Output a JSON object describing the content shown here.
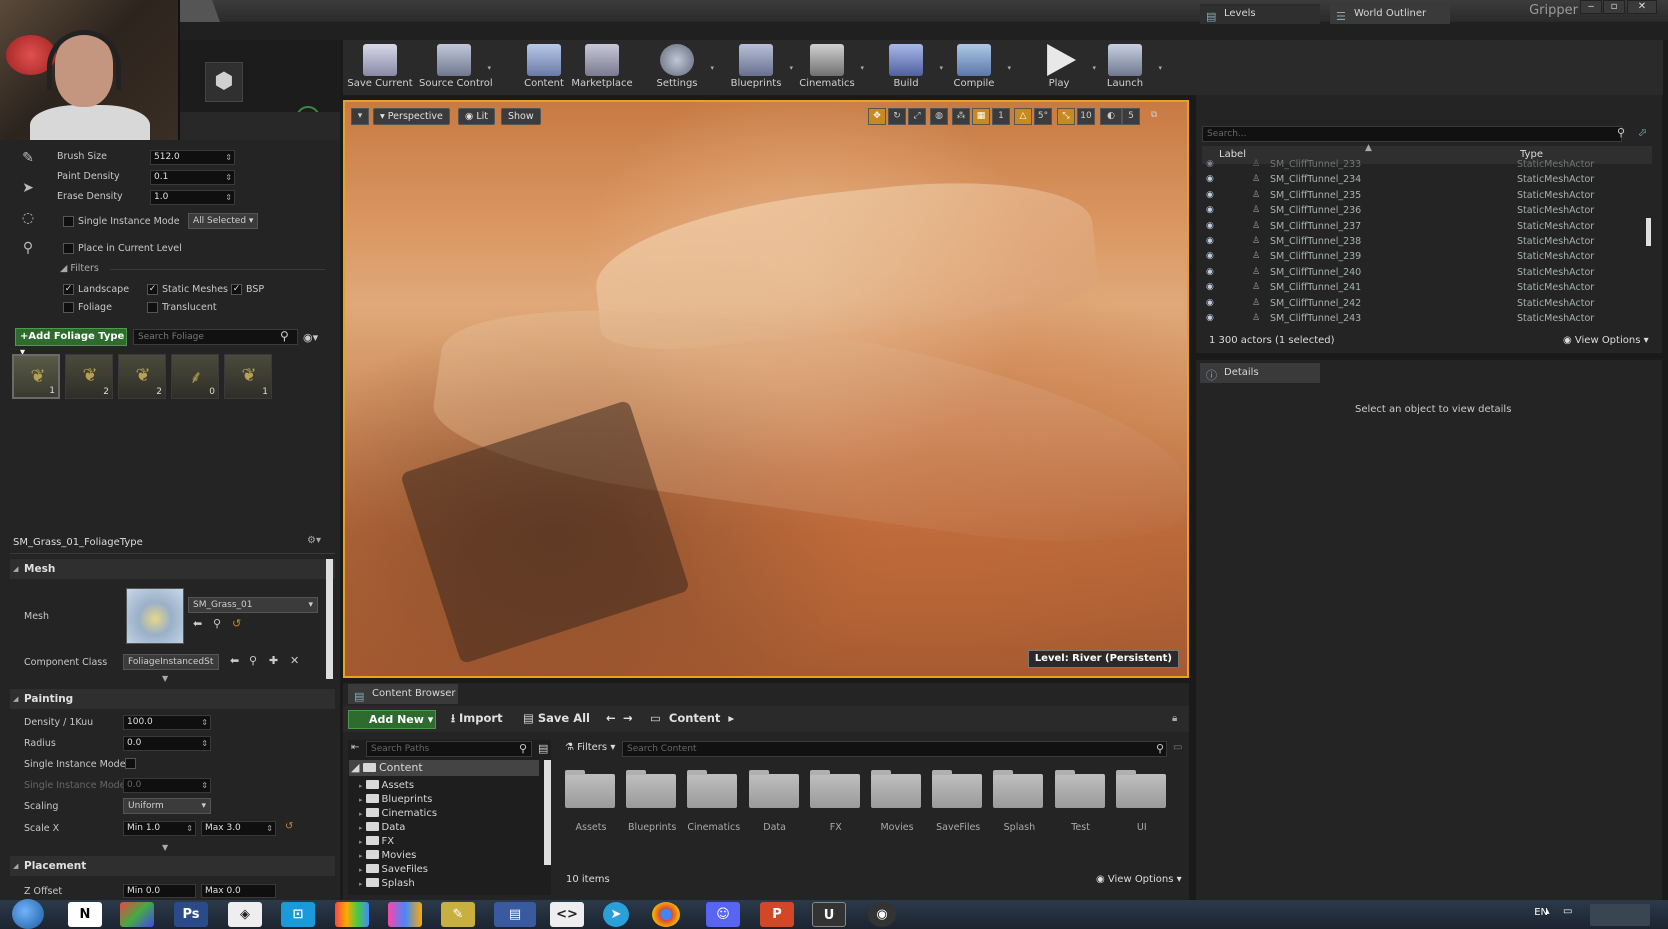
{
  "window": {
    "title": "Gripper",
    "min": "‒",
    "max": "▫",
    "close": "✕"
  },
  "toolbar": {
    "items": [
      {
        "label": "Save Current",
        "icon": "save-icon"
      },
      {
        "label": "Source Control",
        "icon": "source-control-icon"
      },
      {
        "label": "Content",
        "icon": "content-icon"
      },
      {
        "label": "Marketplace",
        "icon": "marketplace-icon"
      },
      {
        "label": "Settings",
        "icon": "settings-icon"
      },
      {
        "label": "Blueprints",
        "icon": "blueprints-icon"
      },
      {
        "label": "Cinematics",
        "icon": "cinematics-icon"
      },
      {
        "label": "Build",
        "icon": "build-icon"
      },
      {
        "label": "Compile",
        "icon": "compile-icon"
      },
      {
        "label": "Play",
        "icon": "play-icon"
      },
      {
        "label": "Launch",
        "icon": "launch-icon"
      }
    ]
  },
  "foliage": {
    "brush_size_label": "Brush Size",
    "brush_size": "512.0",
    "paint_density_label": "Paint Density",
    "paint_density": "0.1",
    "erase_density_label": "Erase Density",
    "erase_density": "1.0",
    "single_instance_label": "Single Instance Mode",
    "single_instance_value": "All Selected",
    "place_current_label": "Place in Current Level",
    "filters_label": "Filters",
    "filters": [
      {
        "label": "Landscape",
        "checked": true
      },
      {
        "label": "Static Meshes",
        "checked": true
      },
      {
        "label": "BSP",
        "checked": true
      },
      {
        "label": "Foliage",
        "checked": false
      },
      {
        "label": "Translucent",
        "checked": false
      }
    ],
    "add_type_label": "+Add Foliage Type",
    "search_placeholder": "Search Foliage",
    "types": [
      {
        "count": "1"
      },
      {
        "count": "2"
      },
      {
        "count": "2"
      },
      {
        "count": "0"
      },
      {
        "count": "1"
      }
    ],
    "type_name": "SM_Grass_01_FoliageType",
    "mesh_section": "Mesh",
    "mesh_label": "Mesh",
    "mesh_value": "SM_Grass_01",
    "component_class_label": "Component Class",
    "component_class_value": "FoliageInstancedSt",
    "painting_section": "Painting",
    "density_label": "Density / 1Kuu",
    "density": "100.0",
    "radius_label": "Radius",
    "radius": "0.0",
    "single_instance_mode_label": "Single Instance Mode",
    "single_instance_mode2_label": "Single Instance Mode",
    "single_instance_mode2": "0.0",
    "scaling_label": "Scaling",
    "scaling": "Uniform",
    "scale_x_label": "Scale X",
    "scale_x_min": "Min  1.0",
    "scale_x_max": "Max  3.0",
    "placement_section": "Placement",
    "z_offset_label": "Z Offset",
    "z_offset_min": "Min  0.0",
    "z_offset_max": "Max  0.0"
  },
  "viewport": {
    "perspective": "Perspective",
    "lit": "Lit",
    "show": "Show",
    "snap_grid": "1",
    "snap_rot": "5°",
    "snap_scale": "10",
    "camera_speed": "5",
    "level_label": "Level:  River (Persistent)"
  },
  "outliner": {
    "tab_levels": "Levels",
    "tab_world": "World Outliner",
    "search_placeholder": "Search...",
    "col_label": "Label",
    "col_type": "Type",
    "rows": [
      {
        "name": "SM_CliffTunnel_233",
        "type": "StaticMeshActor"
      },
      {
        "name": "SM_CliffTunnel_234",
        "type": "StaticMeshActor"
      },
      {
        "name": "SM_CliffTunnel_235",
        "type": "StaticMeshActor"
      },
      {
        "name": "SM_CliffTunnel_236",
        "type": "StaticMeshActor"
      },
      {
        "name": "SM_CliffTunnel_237",
        "type": "StaticMeshActor"
      },
      {
        "name": "SM_CliffTunnel_238",
        "type": "StaticMeshActor"
      },
      {
        "name": "SM_CliffTunnel_239",
        "type": "StaticMeshActor"
      },
      {
        "name": "SM_CliffTunnel_240",
        "type": "StaticMeshActor"
      },
      {
        "name": "SM_CliffTunnel_241",
        "type": "StaticMeshActor"
      },
      {
        "name": "SM_CliffTunnel_242",
        "type": "StaticMeshActor"
      },
      {
        "name": "SM_CliffTunnel_243",
        "type": "StaticMeshActor"
      }
    ],
    "actor_count": "1 300 actors (1 selected)",
    "view_options": "View Options"
  },
  "details": {
    "tab": "Details",
    "empty_message": "Select an object to view details"
  },
  "content_browser": {
    "tab": "Content Browser",
    "add_new": "Add New",
    "import": "Import",
    "save_all": "Save All",
    "path": "Content",
    "search_paths_placeholder": "Search Paths",
    "filters": "Filters",
    "search_content_placeholder": "Search Content",
    "tree_root": "Content",
    "tree": [
      "Assets",
      "Blueprints",
      "Cinematics",
      "Data",
      "FX",
      "Movies",
      "SaveFiles",
      "Splash"
    ],
    "folders": [
      "Assets",
      "Blueprints",
      "Cinematics",
      "Data",
      "FX",
      "Movies",
      "SaveFiles",
      "Splash",
      "Test",
      "UI"
    ],
    "item_count": "10 items",
    "view_options": "View Options"
  },
  "taskbar": {
    "lang": "EN"
  }
}
